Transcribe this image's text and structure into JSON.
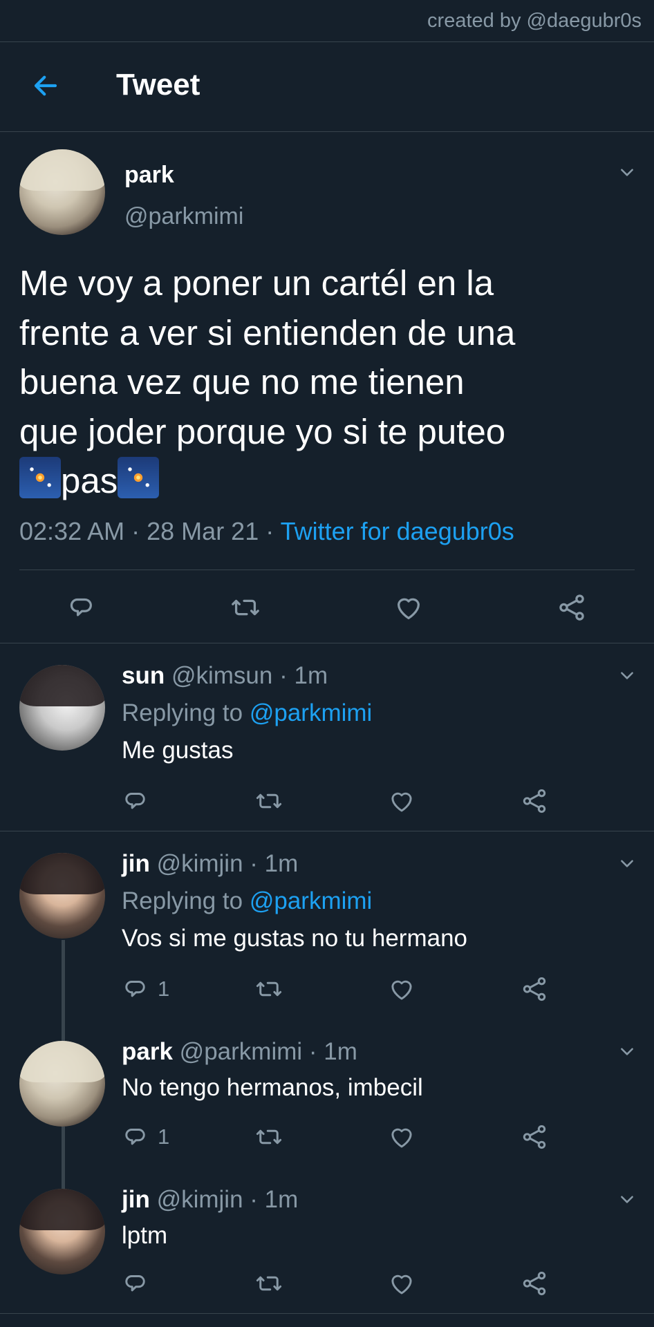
{
  "credit": "created by @daegubr0s",
  "header": {
    "title": "Tweet"
  },
  "main_tweet": {
    "name": "park",
    "handle": "@parkmimi",
    "text_lines": [
      "Me voy a poner un cartél en la",
      "frente a ver si entienden de una",
      "buena vez que no me tienen",
      "que joder porque yo si te puteo"
    ],
    "last_word": "pas",
    "emoji": "fireworks-emoji",
    "time": "02:32 AM",
    "date": "28 Mar 21",
    "source": "Twitter for daegubr0s"
  },
  "replies": [
    {
      "name": "sun",
      "handle": "@kimsun",
      "time": "1m",
      "replying_label": "Replying to",
      "replying_to": "@parkmimi",
      "text": "Me gustas",
      "reply_count": ""
    },
    {
      "name": "jin",
      "handle": "@kimjin",
      "time": "1m",
      "replying_label": "Replying to",
      "replying_to": "@parkmimi",
      "text": "Vos si me gustas no tu hermano",
      "reply_count": "1"
    },
    {
      "name": "park",
      "handle": "@parkmimi",
      "time": "1m",
      "text": "No tengo hermanos, imbecil",
      "reply_count": "1"
    },
    {
      "name": "jin",
      "handle": "@kimjin",
      "time": "1m",
      "text": "lptm",
      "reply_count": ""
    }
  ],
  "separator": "·",
  "colors": {
    "background": "#15202b",
    "accent": "#1da1f2",
    "secondary_text": "#8899a6",
    "divider": "#38444d"
  },
  "icons": [
    "back-arrow-icon",
    "chevron-down-icon",
    "reply-icon",
    "retweet-icon",
    "like-icon",
    "share-icon"
  ]
}
